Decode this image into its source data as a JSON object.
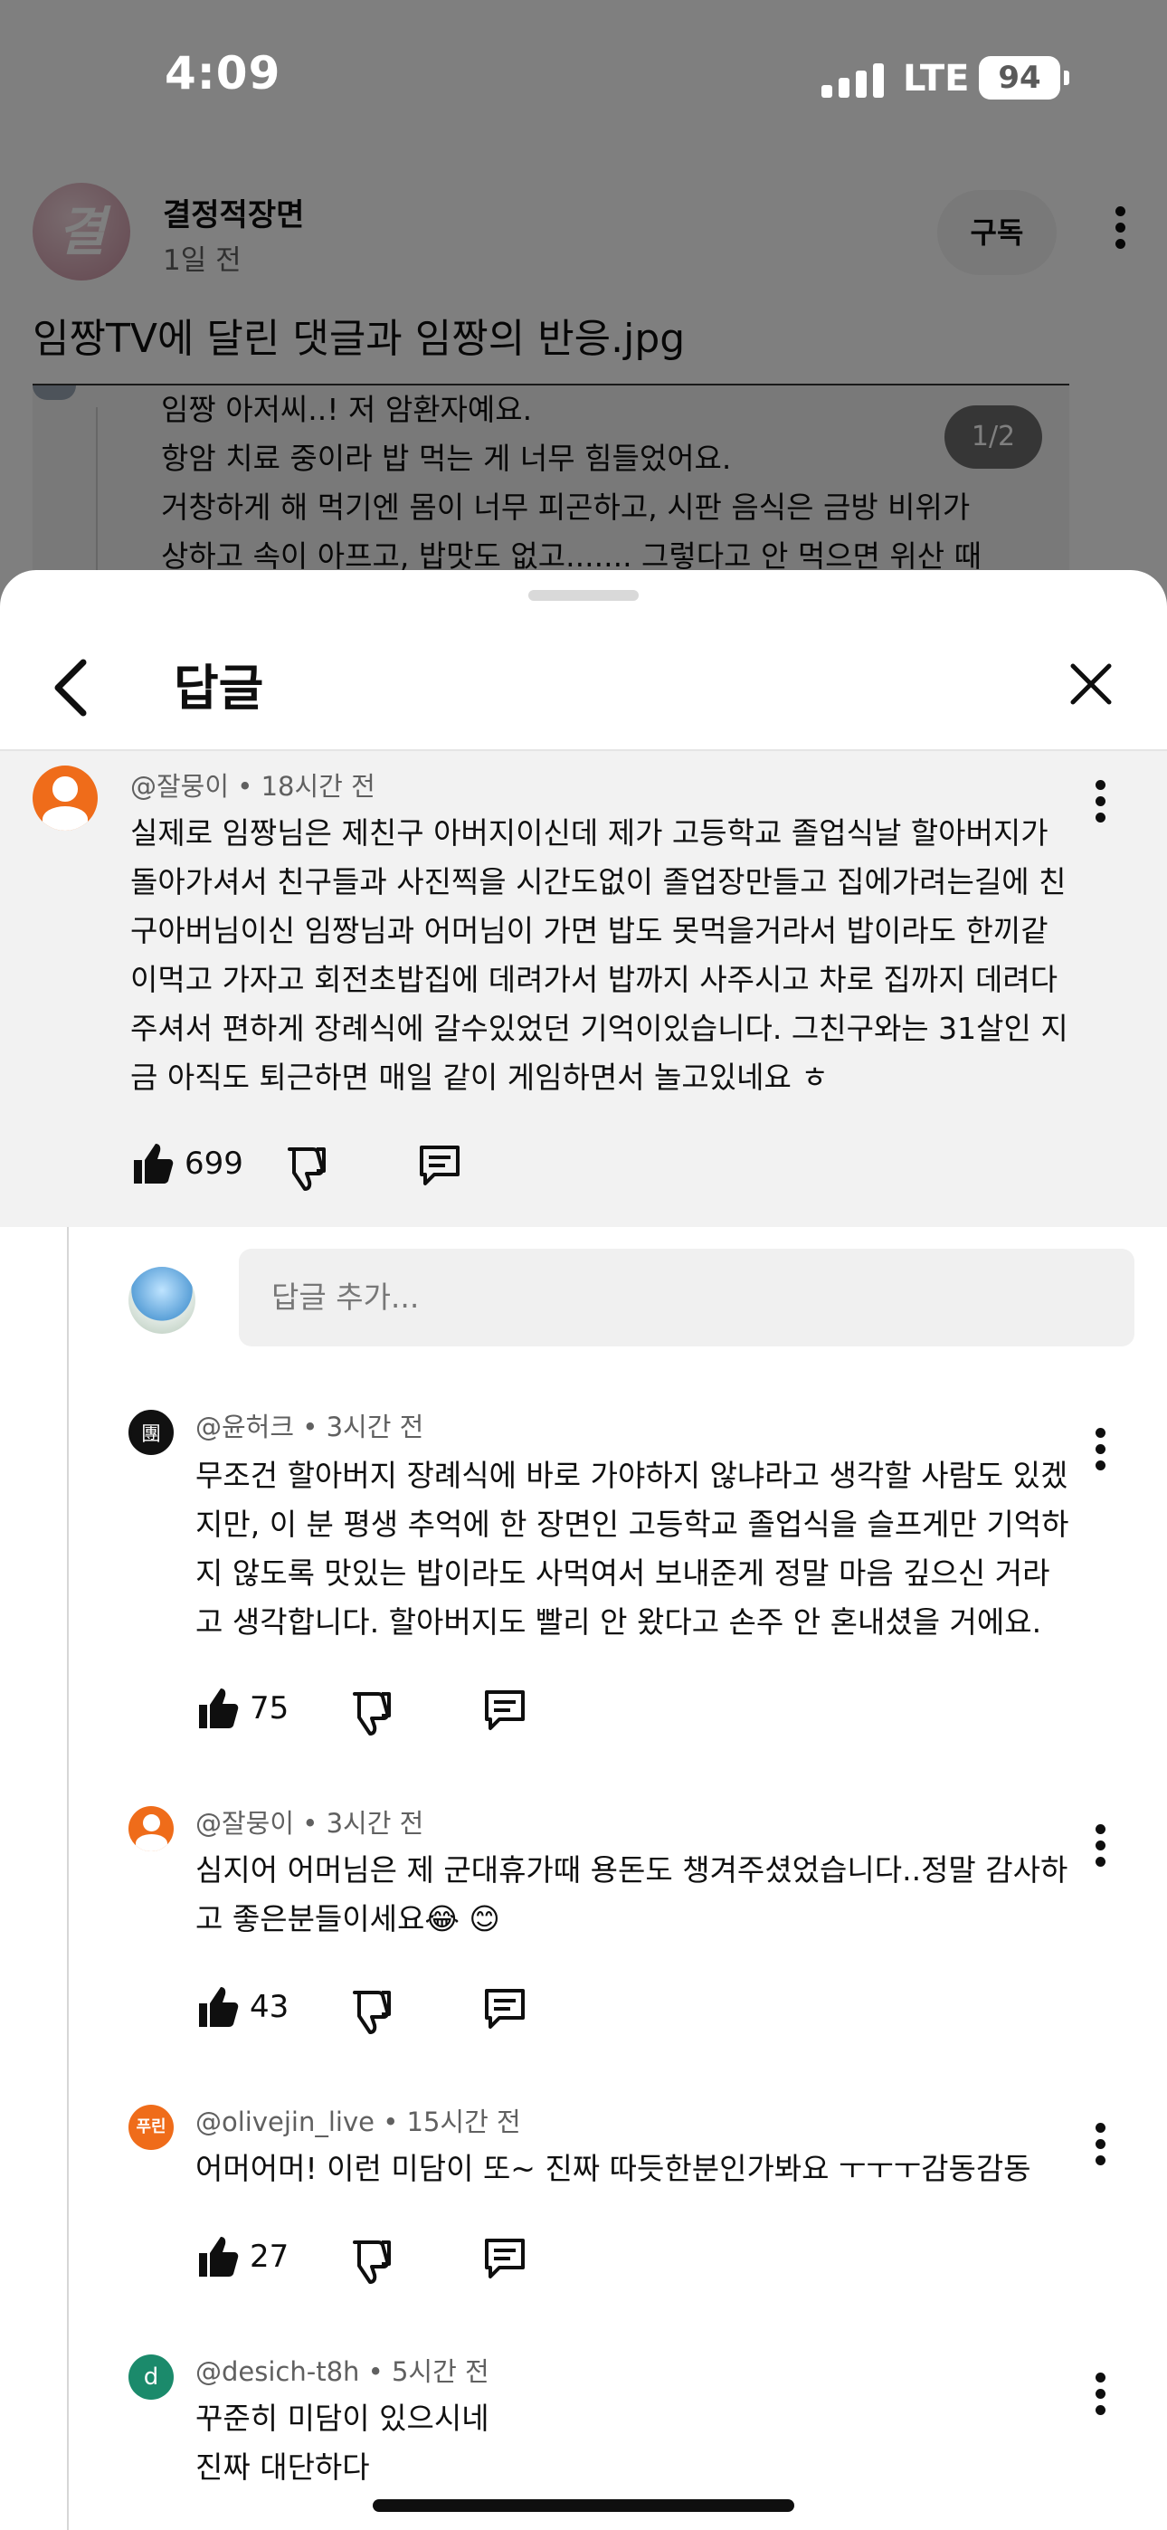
{
  "status": {
    "time": "4:09",
    "network": "LTE",
    "battery": "94"
  },
  "post": {
    "channel_avatar_text": "결",
    "channel": "결정적장면",
    "age": "1일 전",
    "subscribe_label": "구독",
    "title": "임짱TV에 달린 댓글과 임짱의 반응.jpg",
    "image_page": "1/2",
    "quoted_lines": [
      "임짱 아저씨..! 저 암환자예요.",
      "항암 치료 중이라 밥 먹는 게 너무 힘들었어요.",
      "거창하게 해 먹기엔 몸이 너무 피곤하고, 시판 음식은 금방 비위가",
      "상하고 속이 아프고, 밥맛도 없고....... 그렇다고 안 먹으면 위산 때"
    ]
  },
  "sheet": {
    "title": "답글",
    "reply_placeholder": "답글 추가..."
  },
  "parent_comment": {
    "author": "@잘뭉이",
    "time": "18시간 전",
    "lines": [
      "실제로 임짱님은 제친구 아버지이신데 제가 고등학교 졸업식날 할아버지가",
      "돌아가셔서 친구들과 사진찍을 시간도없이 졸업장만들고 집에가려는길에 친",
      "구아버님이신 임짱님과 어머님이 가면 밥도 못먹을거라서 밥이라도 한끼같",
      "이먹고 가자고 회전초밥집에 데려가서 밥까지 사주시고 차로 집까지 데려다",
      "주셔서 편하게 장례식에 갈수있었던 기억이있습니다. 그친구와는 31살인 지",
      "금 아직도 퇴근하면 매일 같이 게임하면서 놀고있네요 ㅎ"
    ],
    "likes": "699"
  },
  "replies": [
    {
      "author": "@윤허크",
      "time": "3시간 전",
      "avatar_text": "團",
      "lines": [
        "무조건 할아버지 장례식에 바로 가야하지 않냐라고 생각할 사람도 있겠",
        "지만, 이 분 평생 추억에 한 장면인 고등학교 졸업식을 슬프게만 기억하",
        "지 않도록 맛있는 밥이라도 사먹여서 보내준게 정말 마음 깊으신 거라",
        "고 생각합니다. 할아버지도 빨리 안 왔다고 손주 안 혼내셨을 거에요."
      ],
      "likes": "75"
    },
    {
      "author": "@잘뭉이",
      "time": "3시간 전",
      "lines": [
        "심지어 어머님은 제 군대휴가때 용돈도 챙겨주셨었습니다..정말 감사하",
        "고 좋은분들이세요😂 😊"
      ],
      "likes": "43"
    },
    {
      "author": "@olivejin_live",
      "time": "15시간 전",
      "avatar_text": "푸린",
      "lines": [
        "어머어머! 이런 미담이 또~ 진짜 따듯한분인가봐요 ㅜㅜㅜ감동감동"
      ],
      "likes": "27"
    },
    {
      "author": "@desich-t8h",
      "time": "5시간 전",
      "avatar_text": "d",
      "lines": [
        "꾸준히 미담이 있으시네",
        "진짜 대단하다"
      ]
    }
  ],
  "colors": {
    "like_accent": "#0f0f0f",
    "avatar_orange": "#ef6c1a",
    "avatar_teal": "#1b8a6b",
    "sheet_bg": "#ffffff",
    "highlight_bg": "#f2f2f2"
  }
}
